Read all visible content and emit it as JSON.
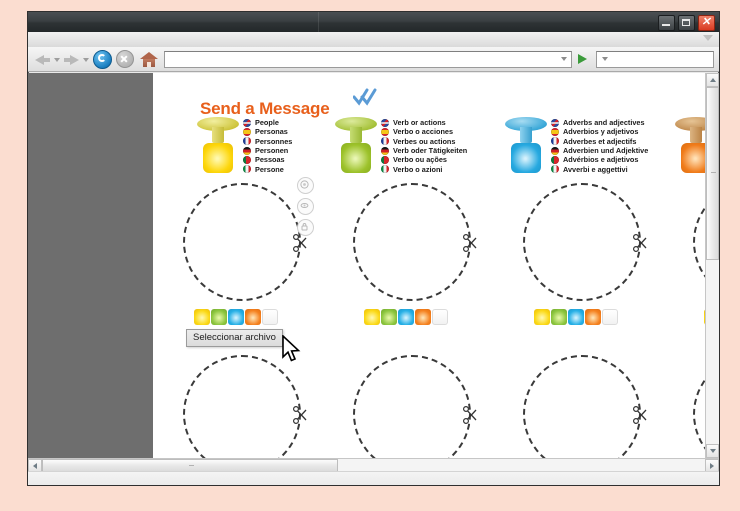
{
  "browser": {
    "window_title": "",
    "titlebar_buttons": [
      {
        "name": "minimize",
        "glyph": "–"
      },
      {
        "name": "maximize",
        "glyph": "□"
      },
      {
        "name": "close",
        "glyph": "✕"
      }
    ],
    "toolbar": {
      "back_icon": "back-arrow-icon",
      "forward_icon": "forward-arrow-icon",
      "reload_icon": "reload-icon",
      "stop_icon": "stop-icon",
      "home_icon": "home-icon",
      "address_value": "",
      "address_placeholder": "",
      "go_icon": "go-arrow-icon",
      "search_value": "",
      "search_placeholder": "",
      "search_icon": "magnifier-icon"
    },
    "scroll": {
      "vertical_up_icon": "chevron-up-icon",
      "vertical_down_icon": "chevron-down-icon",
      "horizontal_left_icon": "chevron-left-icon",
      "horizontal_right_icon": "chevron-right-icon"
    }
  },
  "page": {
    "title": "Send a Message",
    "title_color": "#e8601c",
    "check_mark_icon": "double-check-icon",
    "check_color": "#5b9bd5",
    "legend": [
      {
        "pin_color": "#d9cf45",
        "square_color": "#fdd60a",
        "pin_name": "yellow-pushpin",
        "entries": [
          {
            "flag": "uk",
            "text": "People"
          },
          {
            "flag": "es",
            "text": "Personas"
          },
          {
            "flag": "fr",
            "text": "Personnes"
          },
          {
            "flag": "de",
            "text": "Personen"
          },
          {
            "flag": "pt",
            "text": "Pessoas"
          },
          {
            "flag": "it",
            "text": "Persone"
          }
        ]
      },
      {
        "pin_color": "#a8c43c",
        "square_color": "#9dc22b",
        "pin_name": "green-pushpin",
        "entries": [
          {
            "flag": "uk",
            "text": "Verb or actions"
          },
          {
            "flag": "es",
            "text": "Verbo o acciones"
          },
          {
            "flag": "fr",
            "text": "Verbes ou actions"
          },
          {
            "flag": "de",
            "text": "Verb oder Tätigkeiten"
          },
          {
            "flag": "pt",
            "text": "Verbo ou ações"
          },
          {
            "flag": "it",
            "text": "Verbo o azioni"
          }
        ]
      },
      {
        "pin_color": "#3aa8d8",
        "square_color": "#27a9e0",
        "pin_name": "blue-pushpin",
        "entries": [
          {
            "flag": "uk",
            "text": "Adverbs and adjectives"
          },
          {
            "flag": "es",
            "text": "Adverbios y adjetivos"
          },
          {
            "flag": "fr",
            "text": "Adverbes et adjectifs"
          },
          {
            "flag": "de",
            "text": "Adverbien und Adjektive"
          },
          {
            "flag": "pt",
            "text": "Advérbios e adjetivos"
          },
          {
            "flag": "it",
            "text": "Avverbi e aggettivi"
          }
        ]
      },
      {
        "pin_color": "#c98a4a",
        "square_color": "#f07c1b",
        "pin_name": "orange-pushpin",
        "entries": [
          {
            "flag": "uk",
            "text": ""
          },
          {
            "flag": "es",
            "text": ""
          },
          {
            "flag": "fr",
            "text": ""
          },
          {
            "flag": "de",
            "text": ""
          },
          {
            "flag": "pt",
            "text": ""
          },
          {
            "flag": "it",
            "text": ""
          }
        ]
      }
    ],
    "swatch_colors": [
      "yellow",
      "green",
      "blue",
      "orange",
      "white"
    ],
    "tools": [
      {
        "name": "move-tool-icon"
      },
      {
        "name": "eye-tool-icon"
      },
      {
        "name": "lock-tool-icon"
      }
    ],
    "cut_icon": "scissors-icon",
    "cut_circle_icon": "dashed-circle",
    "tooltip": {
      "text": "Seleccionar archivo",
      "cursor_icon": "mouse-pointer-icon"
    }
  }
}
